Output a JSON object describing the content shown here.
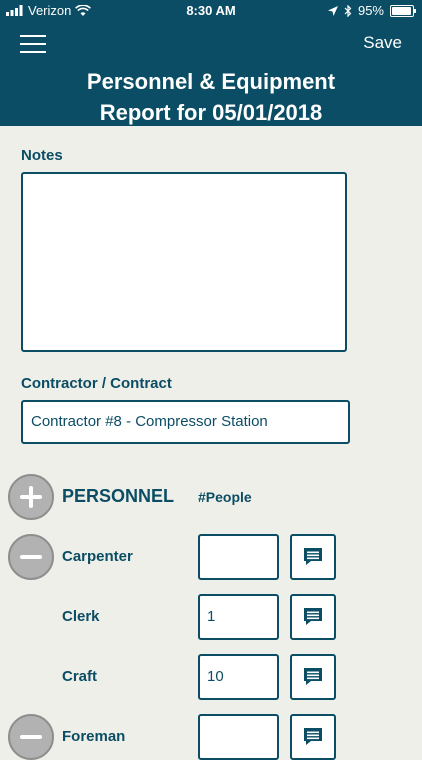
{
  "status_bar": {
    "carrier": "Verizon",
    "time": "8:30 AM",
    "battery": "95%",
    "battery_level": 0.95
  },
  "nav": {
    "save_label": "Save",
    "title_line1": "Personnel & Equipment",
    "title_line2": "Report for 05/01/2018"
  },
  "notes": {
    "label": "Notes",
    "value": ""
  },
  "contractor": {
    "label": "Contractor / Contract",
    "value": "Contractor #8 - Compressor Station"
  },
  "personnel": {
    "heading": "PERSONNEL",
    "count_header": "#People",
    "rows": [
      {
        "label": "Carpenter",
        "count": ""
      },
      {
        "label": "Clerk",
        "count": "1"
      },
      {
        "label": "Craft",
        "count": "10"
      },
      {
        "label": "Foreman",
        "count": ""
      }
    ]
  },
  "colors": {
    "primary": "#0b4d64",
    "background": "#efefe9",
    "circle": "#b2b2b2"
  }
}
